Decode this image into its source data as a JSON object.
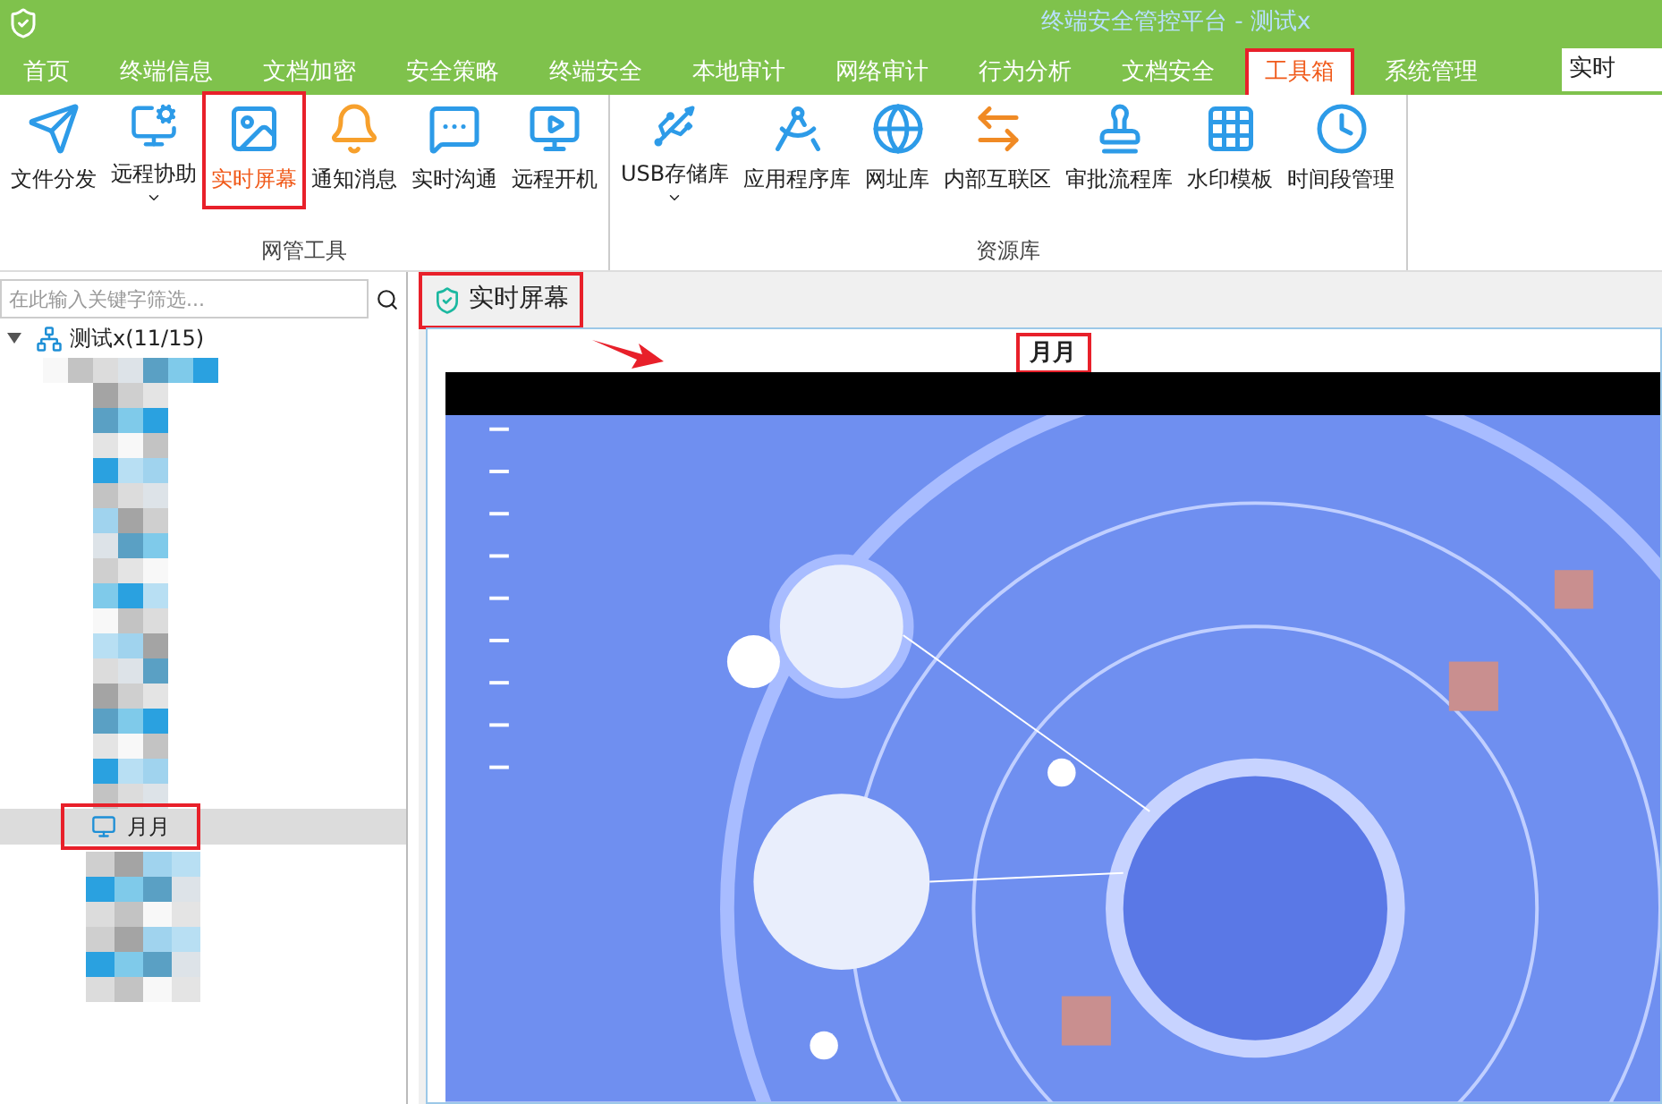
{
  "window": {
    "title": "终端安全管控平台 - 测试x"
  },
  "menu_tabs": [
    {
      "label": "首页",
      "selected": false,
      "annotated": false
    },
    {
      "label": "终端信息",
      "selected": false,
      "annotated": false
    },
    {
      "label": "文档加密",
      "selected": false,
      "annotated": false
    },
    {
      "label": "安全策略",
      "selected": false,
      "annotated": false
    },
    {
      "label": "终端安全",
      "selected": false,
      "annotated": false
    },
    {
      "label": "本地审计",
      "selected": false,
      "annotated": false
    },
    {
      "label": "网络审计",
      "selected": false,
      "annotated": false
    },
    {
      "label": "行为分析",
      "selected": false,
      "annotated": false
    },
    {
      "label": "文档安全",
      "selected": false,
      "annotated": false
    },
    {
      "label": "工具箱",
      "selected": true,
      "annotated": true
    },
    {
      "label": "系统管理",
      "selected": false,
      "annotated": false
    }
  ],
  "menu_search": {
    "value": "实时"
  },
  "ribbon_groups": [
    {
      "label": "网管工具",
      "items": [
        {
          "label": "文件分发",
          "has_menu": false,
          "selected": false,
          "annotated": false
        },
        {
          "label": "远程协助",
          "has_menu": true,
          "selected": false,
          "annotated": false
        },
        {
          "label": "实时屏幕",
          "has_menu": false,
          "selected": true,
          "annotated": true
        },
        {
          "label": "通知消息",
          "has_menu": false,
          "selected": false,
          "annotated": false
        },
        {
          "label": "实时沟通",
          "has_menu": false,
          "selected": false,
          "annotated": false
        },
        {
          "label": "远程开机",
          "has_menu": false,
          "selected": false,
          "annotated": false
        }
      ]
    },
    {
      "label": "资源库",
      "items": [
        {
          "label": "USB存储库",
          "has_menu": true,
          "selected": false,
          "annotated": false
        },
        {
          "label": "应用程序库",
          "has_menu": false,
          "selected": false,
          "annotated": false
        },
        {
          "label": "网址库",
          "has_menu": false,
          "selected": false,
          "annotated": false
        },
        {
          "label": "内部互联区",
          "has_menu": false,
          "selected": false,
          "annotated": false
        },
        {
          "label": "审批流程库",
          "has_menu": false,
          "selected": false,
          "annotated": false
        },
        {
          "label": "水印模板",
          "has_menu": false,
          "selected": false,
          "annotated": false
        },
        {
          "label": "时间段管理",
          "has_menu": false,
          "selected": false,
          "annotated": false
        }
      ]
    }
  ],
  "tree_filter": {
    "placeholder": "在此输入关键字筛选..."
  },
  "tree": {
    "label": "测试x(11/15)",
    "expanded": true,
    "children": [
      {
        "label": "月月",
        "selected": true,
        "annotated": true
      }
    ]
  },
  "panel": {
    "title": "实时屏幕",
    "title_annotated": true,
    "screen_user": "月月",
    "screen_user_annotated": true
  }
}
